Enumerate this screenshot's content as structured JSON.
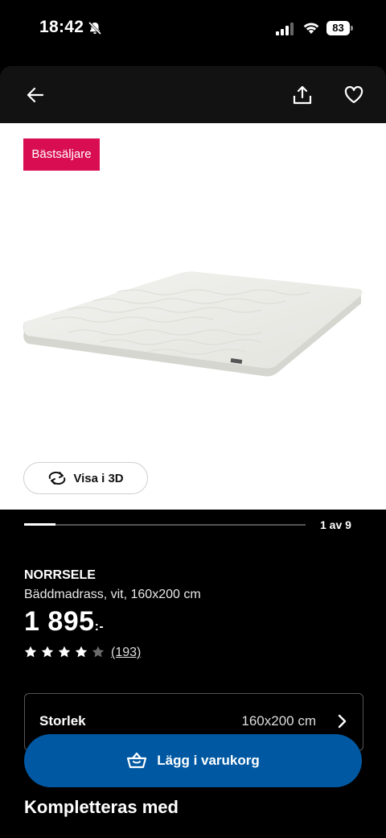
{
  "status_bar": {
    "time": "18:42",
    "battery": "83"
  },
  "header": {
    "back_icon": "arrow-left-icon",
    "share_icon": "share-icon",
    "favorite_icon": "heart-icon"
  },
  "gallery": {
    "badge": "Bästsäljare",
    "view_3d_label": "Visa i 3D",
    "counter": "1 av 9",
    "progress_fraction": 0.11
  },
  "product": {
    "name": "NORRSELE",
    "description": "Bäddmadrass, vit, 160x200 cm",
    "price": "1 895",
    "price_suffix": ":-",
    "rating": 4,
    "rating_max": 5,
    "reviews": "(193)"
  },
  "size_selector": {
    "label": "Storlek",
    "value": "160x200 cm"
  },
  "cart_button": {
    "label": "Lägg i varukorg"
  },
  "complement": {
    "title": "Kompletteras med"
  },
  "colors": {
    "badge": "#d90e52",
    "cart": "#0058a3"
  }
}
